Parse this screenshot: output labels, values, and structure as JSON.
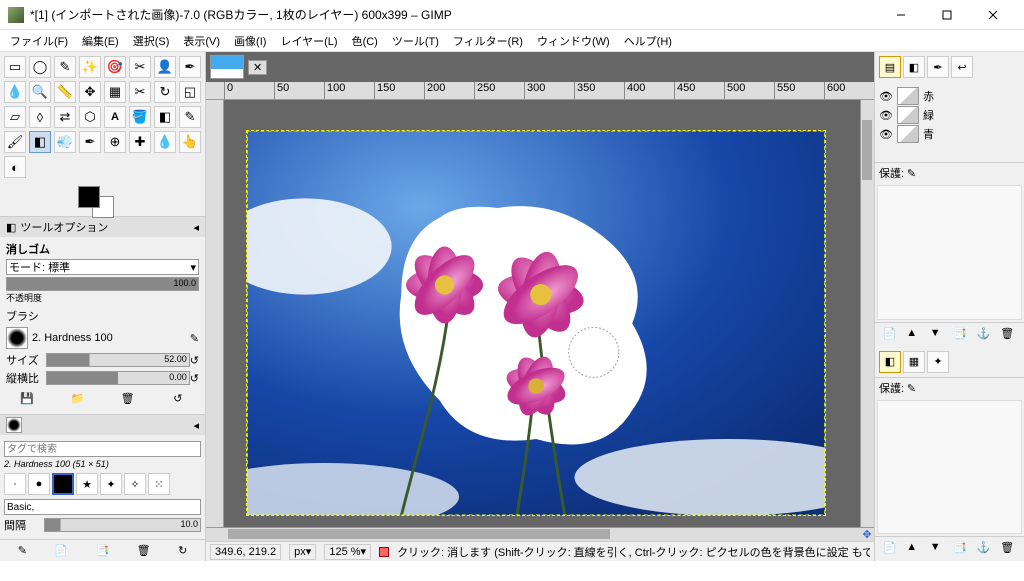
{
  "window": {
    "title": "*[1] (インポートされた画像)-7.0 (RGBカラー, 1枚のレイヤー) 600x399 – GIMP"
  },
  "menu": [
    "ファイル(F)",
    "編集(E)",
    "選択(S)",
    "表示(V)",
    "画像(I)",
    "レイヤー(L)",
    "色(C)",
    "ツール(T)",
    "フィルター(R)",
    "ウィンドウ(W)",
    "ヘルプ(H)"
  ],
  "tool_options": {
    "title": "ツールオプション",
    "tool_name": "消しゴム",
    "mode_label": "モード: 標準",
    "opacity_label": "不透明度",
    "opacity_value": "100.0",
    "brush_label": "ブラシ",
    "brush_name": "2. Hardness 100",
    "size_label": "サイズ",
    "size_value": "52.00",
    "ratio_label": "縦横比",
    "ratio_value": "0.00"
  },
  "brushes": {
    "search_placeholder": "タグで検索",
    "current": "2. Hardness 100 (51 × 51)",
    "category": "Basic,",
    "spacing_label": "間隔",
    "spacing_value": "10.0"
  },
  "layers": {
    "items": [
      {
        "name": "赤"
      },
      {
        "name": "緑"
      },
      {
        "name": "青"
      }
    ],
    "section_label": "保護:"
  },
  "right_lower": {
    "section_label": "保護:"
  },
  "status": {
    "coords": "349.6, 219.2",
    "unit": "px",
    "zoom": "125 %",
    "hint": "クリック: 消します (Shift-クリック: 直線を引く, Ctrl-クリック: ピクセルの色を背景色に設定 もできます)"
  },
  "ruler_ticks": [
    "0",
    "50",
    "100",
    "150",
    "200",
    "250",
    "300",
    "350",
    "400",
    "450",
    "500",
    "550",
    "600"
  ]
}
